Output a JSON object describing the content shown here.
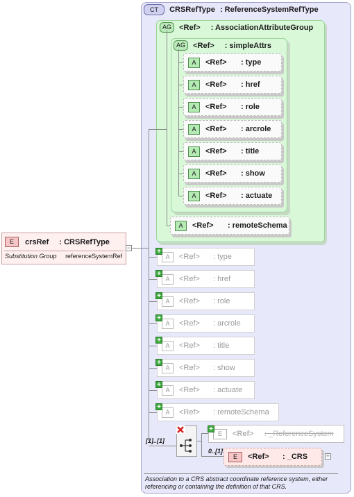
{
  "complex_type": {
    "badge": "CT",
    "name": "CRSRefType",
    "type": ": ReferenceSystemRefType"
  },
  "root_element": {
    "badge": "E",
    "name": "crsRef",
    "type": ": CRSRefType",
    "substitution_label": "Substitution Group",
    "substitution_value": "referenceSystemRef",
    "collapse_glyph": "−"
  },
  "association_group": {
    "badge": "AG",
    "ref": "<Ref>",
    "name": ": AssociationAttributeGroup"
  },
  "simple_attrs_group": {
    "badge": "AG",
    "ref": "<Ref>",
    "name": ": simpleAttrs",
    "attributes": [
      {
        "badge": "A",
        "ref": "<Ref>",
        "name": ": type"
      },
      {
        "badge": "A",
        "ref": "<Ref>",
        "name": ": href"
      },
      {
        "badge": "A",
        "ref": "<Ref>",
        "name": ": role"
      },
      {
        "badge": "A",
        "ref": "<Ref>",
        "name": ": arcrole"
      },
      {
        "badge": "A",
        "ref": "<Ref>",
        "name": ": title"
      },
      {
        "badge": "A",
        "ref": "<Ref>",
        "name": ": show"
      },
      {
        "badge": "A",
        "ref": "<Ref>",
        "name": ": actuate"
      }
    ]
  },
  "remote_schema_attr": {
    "badge": "A",
    "ref": "<Ref>",
    "name": ": remoteSchema"
  },
  "collapsed_attributes": [
    {
      "badge": "A",
      "ref": "<Ref>",
      "name": ": type"
    },
    {
      "badge": "A",
      "ref": "<Ref>",
      "name": ": href"
    },
    {
      "badge": "A",
      "ref": "<Ref>",
      "name": ": role"
    },
    {
      "badge": "A",
      "ref": "<Ref>",
      "name": ": arcrole"
    },
    {
      "badge": "A",
      "ref": "<Ref>",
      "name": ": title"
    },
    {
      "badge": "A",
      "ref": "<Ref>",
      "name": ": show"
    },
    {
      "badge": "A",
      "ref": "<Ref>",
      "name": ": actuate"
    },
    {
      "badge": "A",
      "ref": "<Ref>",
      "name": ": remoteSchema"
    }
  ],
  "expand_glyph": "+",
  "choice": {
    "cardinality": "[1]..[1]",
    "options": [
      {
        "badge": "E",
        "ref": "<Ref>",
        "name": ": _ReferenceSystem",
        "cardinality": "",
        "disabled": true
      },
      {
        "badge": "E",
        "ref": "<Ref>",
        "name": ": _CRS",
        "cardinality": "0..[1]",
        "disabled": false
      }
    ]
  },
  "documentation": "Association to a CRS abstract coordinate reference system, either referencing or containing the definition of that CRS.",
  "colors": {
    "complex_type_bg": "#e8e8fb",
    "attribute_group_bg": "#d8f8d8",
    "element_bg": "#fff0f0",
    "attribute_badge": "#b5eab5"
  }
}
